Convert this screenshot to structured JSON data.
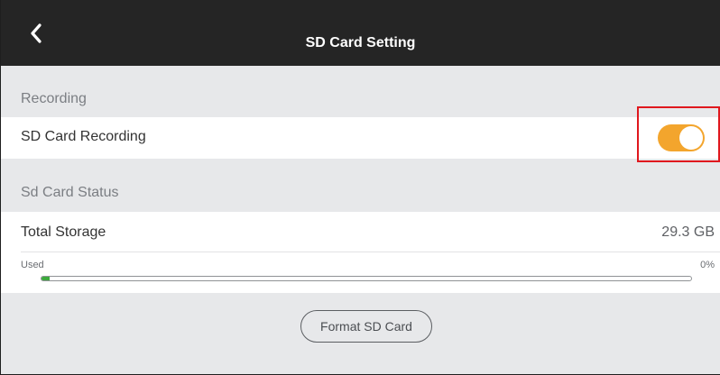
{
  "header": {
    "title": "SD Card Setting",
    "back_icon": "chevron-left-icon",
    "background": "#252525"
  },
  "recording_section": {
    "label": "Recording",
    "sd_card_recording": {
      "label": "SD Card Recording",
      "enabled": true,
      "toggle_color": "#f3a52d"
    }
  },
  "status_section": {
    "label": "Sd Card Status",
    "total_storage": {
      "label": "Total Storage",
      "value": "29.3 GB"
    },
    "used": {
      "label": "Used",
      "percent_text": "0%",
      "fraction": 0.0,
      "bar_color": "#3daa3d"
    }
  },
  "actions": {
    "format_label": "Format SD Card"
  },
  "highlight_color": "#e0181e"
}
